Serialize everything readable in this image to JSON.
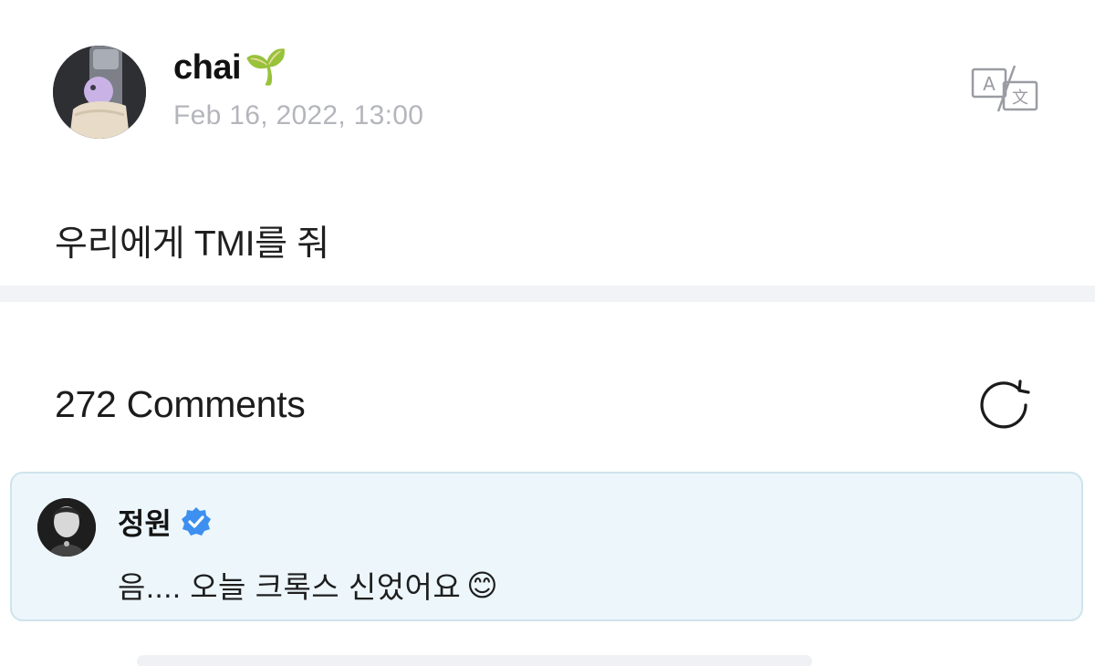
{
  "post": {
    "author_name": "chai",
    "author_emoji": "🌱",
    "date": "Feb 16, 2022, 13:00",
    "body": "우리에게 TMI를 줘",
    "avatar_icon": "avatar-photo-phone-grip",
    "translate_icon": "translate-icon"
  },
  "comments": {
    "header": "272 Comments",
    "refresh_icon": "refresh-icon",
    "items": [
      {
        "author": "정원",
        "verified_icon": "verified-badge-icon",
        "text": "음.... 오늘 크록스 신었어요",
        "emoji": "😊"
      }
    ]
  },
  "colors": {
    "date_gray": "#b4b6bc",
    "comment_bg": "#ecf6fb",
    "comment_border": "#cfe3ec",
    "verified_blue": "#3d8ff0",
    "divider": "#f2f3f7"
  }
}
